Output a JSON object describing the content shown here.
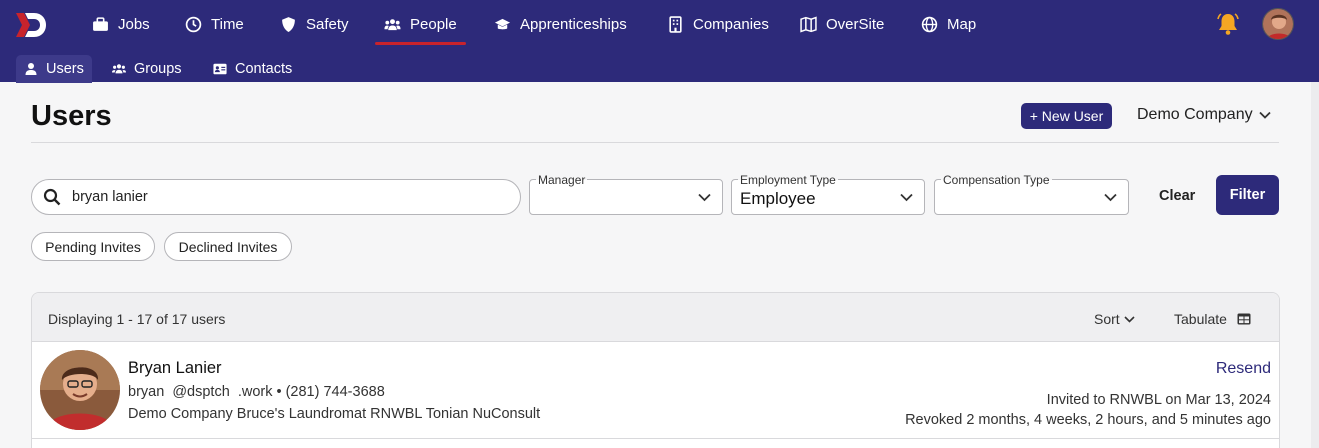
{
  "nav": {
    "items": [
      {
        "label": "Jobs",
        "icon": "briefcase-icon"
      },
      {
        "label": "Time",
        "icon": "clock-icon"
      },
      {
        "label": "Safety",
        "icon": "shield-icon"
      },
      {
        "label": "People",
        "icon": "people-icon",
        "active": true
      },
      {
        "label": "Apprenticeships",
        "icon": "graduation-cap-icon"
      },
      {
        "label": "Companies",
        "icon": "building-icon"
      },
      {
        "label": "OverSite",
        "icon": "map-fold-icon"
      },
      {
        "label": "Map",
        "icon": "globe-icon"
      }
    ],
    "accent_color": "#c8232c",
    "bar_color": "#2d2a7a"
  },
  "subnav": {
    "items": [
      {
        "label": "Users",
        "icon": "user-icon",
        "active": true
      },
      {
        "label": "Groups",
        "icon": "users-icon"
      },
      {
        "label": "Contacts",
        "icon": "address-card-icon"
      }
    ]
  },
  "header": {
    "title": "Users",
    "new_user_label": "+ New User",
    "company": "Demo Company"
  },
  "filters": {
    "search_value": "bryan lanier",
    "manager": {
      "label": "Manager",
      "value": ""
    },
    "employment_type": {
      "label": "Employment Type",
      "value": "Employee"
    },
    "compensation_type": {
      "label": "Compensation Type",
      "value": ""
    },
    "clear_label": "Clear",
    "filter_label": "Filter",
    "pills": [
      "Pending Invites",
      "Declined Invites"
    ]
  },
  "results": {
    "displaying": "Displaying 1 - 17 of 17 users",
    "sort_label": "Sort",
    "tabulate_label": "Tabulate",
    "rows": [
      {
        "name": "Bryan Lanier",
        "contact": "bryan  @dsptch  .work • (281) 744-3688",
        "companies": "Demo Company Bruce's Laundromat RNWBL Tonian NuConsult",
        "action": "Resend",
        "invited": "Invited to RNWBL on Mar 13, 2024",
        "revoked": "Revoked 2 months, 4 weeks, 2 hours, and 5 minutes ago"
      }
    ]
  }
}
